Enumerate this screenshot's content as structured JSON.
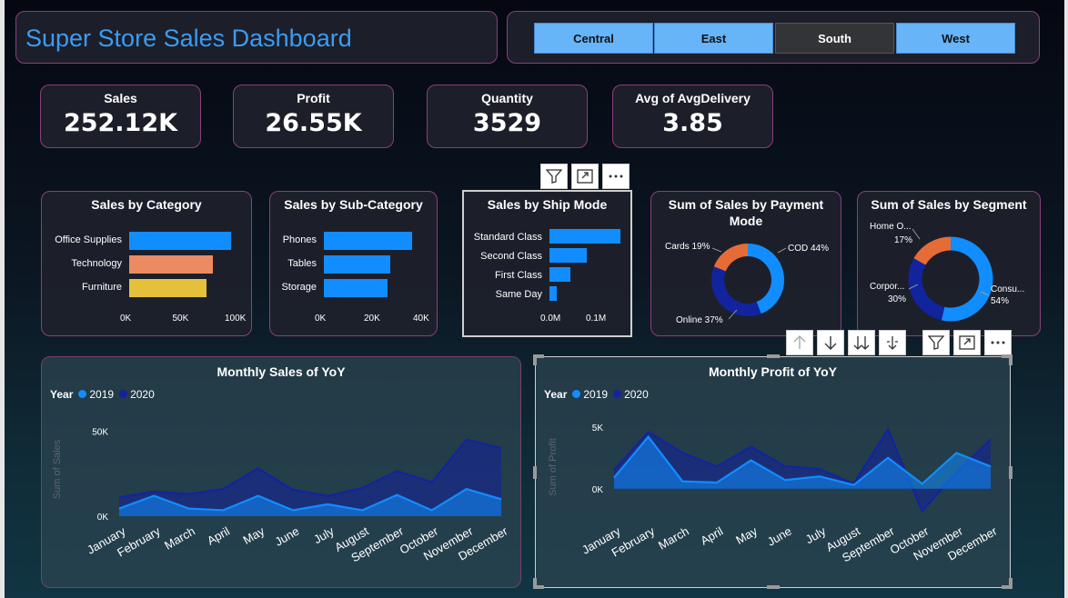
{
  "title": "Super Store Sales Dashboard",
  "slicer": {
    "options": [
      "Central",
      "East",
      "South",
      "West"
    ],
    "selected": "South"
  },
  "kpis": [
    {
      "label": "Sales",
      "value": "252.12K"
    },
    {
      "label": "Profit",
      "value": "26.55K"
    },
    {
      "label": "Quantity",
      "value": "3529"
    },
    {
      "label": "Avg of AvgDelivery",
      "value": "3.85"
    }
  ],
  "toolbar_icons": {
    "filter": "filter-icon",
    "focus": "focus-mode-icon",
    "more": "more-options-icon",
    "sort_up": "arrow-up-icon",
    "sort_down": "arrow-down-icon",
    "drill_all": "double-arrow-down-icon",
    "expand": "expand-hierarchy-icon"
  },
  "colors": {
    "blue": "#118dff",
    "dark_blue": "#12239e",
    "orange": "#e66c37",
    "salmon": "#ec8b62",
    "yellow": "#e5c13b",
    "border": "#8b3f7c"
  },
  "chart_data": [
    {
      "type": "bar",
      "title": "Sales by Category",
      "categories": [
        "Office Supplies",
        "Technology",
        "Furniture"
      ],
      "values": [
        97,
        80,
        74
      ],
      "colors": [
        "#118dff",
        "#ec8b62",
        "#e5c13b"
      ],
      "xticks": [
        "0K",
        "50K",
        "100K"
      ],
      "xlim": [
        0,
        100
      ]
    },
    {
      "type": "bar",
      "title": "Sales by Sub-Category",
      "categories": [
        "Phones",
        "Tables",
        "Storage"
      ],
      "values": [
        36,
        27,
        26
      ],
      "xticks": [
        "0K",
        "20K",
        "40K"
      ],
      "xlim": [
        0,
        40
      ]
    },
    {
      "type": "bar",
      "title": "Sales by Ship Mode",
      "categories": [
        "Standard Class",
        "Second Class",
        "First Class",
        "Same Day"
      ],
      "values": [
        0.155,
        0.082,
        0.046,
        0.015
      ],
      "xticks": [
        "0.0M",
        "0.1M"
      ],
      "xlim": [
        0,
        0.2
      ]
    },
    {
      "type": "pie",
      "title": "Sum of Sales by Payment Mode",
      "slices": [
        {
          "label": "COD 44%",
          "value": 44,
          "color": "#118dff"
        },
        {
          "label": "Online 37%",
          "value": 37,
          "color": "#12239e"
        },
        {
          "label": "Cards 19%",
          "value": 19,
          "color": "#e66c37"
        }
      ]
    },
    {
      "type": "pie",
      "title": "Sum of Sales by Segment",
      "slices": [
        {
          "label": "Consu...",
          "pct": "54%",
          "value": 54,
          "color": "#118dff"
        },
        {
          "label": "Corpor...",
          "pct": "30%",
          "value": 30,
          "color": "#12239e"
        },
        {
          "label": "Home O...",
          "pct": "17%",
          "value": 17,
          "color": "#e66c37"
        }
      ]
    },
    {
      "type": "area",
      "title": "Monthly Sales of YoY",
      "legend_title": "Year",
      "ylabel": "Sum of Sales",
      "yticks": [
        "0K",
        "50K"
      ],
      "ylim": [
        0,
        55000
      ],
      "categories": [
        "January",
        "February",
        "March",
        "April",
        "May",
        "June",
        "July",
        "August",
        "September",
        "October",
        "November",
        "December"
      ],
      "series": [
        {
          "name": "2019",
          "color": "#118dff",
          "values": [
            4500,
            12000,
            4500,
            3500,
            12000,
            3500,
            7000,
            3500,
            12500,
            3500,
            16000,
            10000
          ]
        },
        {
          "name": "2020",
          "color": "#12239e",
          "values": [
            11000,
            14500,
            13000,
            16000,
            28000,
            15500,
            12000,
            16500,
            26500,
            20000,
            45000,
            40000
          ]
        }
      ]
    },
    {
      "type": "line",
      "title": "Monthly Profit of YoY",
      "legend_title": "Year",
      "ylabel": "Sum of Profit",
      "yticks": [
        "0K",
        "5K"
      ],
      "ylim": [
        -2000,
        5500
      ],
      "categories": [
        "January",
        "February",
        "March",
        "April",
        "May",
        "June",
        "July",
        "August",
        "September",
        "October",
        "November",
        "December"
      ],
      "series": [
        {
          "name": "2019",
          "color": "#118dff",
          "values": [
            900,
            4200,
            600,
            500,
            2300,
            700,
            1000,
            300,
            2500,
            400,
            2900,
            1800
          ]
        },
        {
          "name": "2020",
          "color": "#12239e",
          "values": [
            1500,
            4600,
            2900,
            1800,
            3400,
            1800,
            1600,
            400,
            4800,
            -1800,
            1300,
            4000
          ]
        }
      ]
    }
  ]
}
